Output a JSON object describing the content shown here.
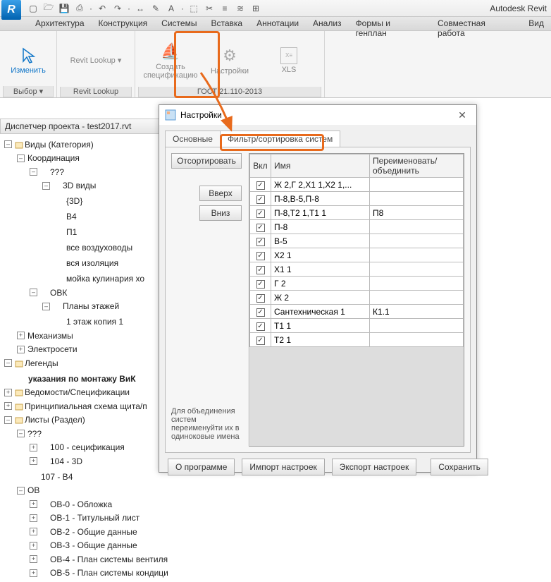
{
  "app_title": "Autodesk Revit",
  "logo_letter": "R",
  "qat_icons": [
    "new-icon",
    "open-icon",
    "save-icon",
    "paste-icon",
    "undo-icon",
    "redo-icon",
    "dimension-icon",
    "measure-icon",
    "text-icon",
    "3d-icon",
    "section-icon",
    "tag-icon",
    "thin-icon",
    "close-icon"
  ],
  "menus": [
    "Архитектура",
    "Конструкция",
    "Системы",
    "Вставка",
    "Аннотации",
    "Анализ",
    "Формы и генплан",
    "Совместная работа",
    "Вид"
  ],
  "ribbon": {
    "groups": [
      {
        "label": "Выбор ▾",
        "buttons": [
          {
            "label": "Изменить",
            "icon": "cursor"
          }
        ]
      },
      {
        "label": "Revit Lookup",
        "buttons": [
          {
            "label": "Revit Lookup ▾",
            "icon": ""
          }
        ]
      },
      {
        "label": "ГОСТ 21.110-2013",
        "buttons": [
          {
            "label": "Создать спецификацию",
            "icon": "boat"
          },
          {
            "label": "Настройки",
            "icon": "gear"
          },
          {
            "label": "XLS",
            "icon": "xls"
          }
        ]
      }
    ]
  },
  "project_browser": {
    "title": "Диспетчер проекта - test2017.rvt",
    "tree": [
      {
        "l": 1,
        "exp": "-",
        "label": "Виды (Категория)",
        "icon": "views"
      },
      {
        "l": 2,
        "exp": "-",
        "label": "Координация"
      },
      {
        "l": 3,
        "exp": "-",
        "label": "???"
      },
      {
        "l": 4,
        "exp": "-",
        "label": "3D виды"
      },
      {
        "l": 5,
        "label": "{3D}"
      },
      {
        "l": 5,
        "label": "B4"
      },
      {
        "l": 5,
        "label": "П1"
      },
      {
        "l": 5,
        "label": "все воздуховоды"
      },
      {
        "l": 5,
        "label": "вся изоляция"
      },
      {
        "l": 5,
        "label": "мойка кулинария хо"
      },
      {
        "l": 3,
        "exp": "-",
        "label": "ОВК"
      },
      {
        "l": 4,
        "exp": "-",
        "label": "Планы этажей"
      },
      {
        "l": 5,
        "label": "1 этаж копия 1"
      },
      {
        "l": 2,
        "exp": "+",
        "label": "Механизмы"
      },
      {
        "l": 2,
        "exp": "+",
        "label": "Электросети"
      },
      {
        "l": 1,
        "exp": "-",
        "label": "Легенды",
        "icon": "legend"
      },
      {
        "l": 2,
        "label": "указания по монтажу ВиК",
        "bold": true
      },
      {
        "l": 1,
        "exp": "+",
        "label": "Ведомости/Спецификации",
        "icon": "sched"
      },
      {
        "l": 1,
        "exp": "+",
        "label": "Принципиальная схема щита/п",
        "icon": "panel"
      },
      {
        "l": 1,
        "exp": "-",
        "label": "Листы (Раздел)",
        "icon": "sheets"
      },
      {
        "l": 2,
        "exp": "-",
        "label": "???"
      },
      {
        "l": 3,
        "exp": "+",
        "label": "100 - сецификация"
      },
      {
        "l": 3,
        "exp": "+",
        "label": "104 - 3D"
      },
      {
        "l": 3,
        "label": "107 - B4"
      },
      {
        "l": 2,
        "exp": "-",
        "label": "ОВ"
      },
      {
        "l": 3,
        "exp": "+",
        "label": "ОВ-0 - Обложка"
      },
      {
        "l": 3,
        "exp": "+",
        "label": "ОВ-1 - Титульный лист"
      },
      {
        "l": 3,
        "exp": "+",
        "label": "ОВ-2 - Общие данные"
      },
      {
        "l": 3,
        "exp": "+",
        "label": "ОВ-3 - Общие данные"
      },
      {
        "l": 3,
        "exp": "+",
        "label": "ОВ-4 - План системы вентиля"
      },
      {
        "l": 3,
        "exp": "+",
        "label": "ОВ-5 - План системы кондици"
      }
    ]
  },
  "dialog": {
    "title": "Настройки",
    "close": "✕",
    "tabs": [
      "Основные",
      "Фильтр/сортировка систем"
    ],
    "buttons": {
      "sort": "Отсортировать",
      "up": "Вверх",
      "down": "Вниз"
    },
    "hint": "Для объединения систем переименуйти их в одиноковые имена",
    "grid": {
      "headers": [
        "Вкл",
        "Имя",
        "Переименовать/объединить"
      ],
      "rows": [
        {
          "on": true,
          "name": "Ж 2,Г 2,X1 1,X2 1,...",
          "rename": ""
        },
        {
          "on": true,
          "name": "П-8,B-5,П-8",
          "rename": ""
        },
        {
          "on": true,
          "name": "П-8,Т2 1,Т1 1",
          "rename": "П8"
        },
        {
          "on": true,
          "name": "П-8",
          "rename": ""
        },
        {
          "on": true,
          "name": "B-5",
          "rename": ""
        },
        {
          "on": true,
          "name": "X2 1",
          "rename": ""
        },
        {
          "on": true,
          "name": "X1 1",
          "rename": ""
        },
        {
          "on": true,
          "name": "Г 2",
          "rename": ""
        },
        {
          "on": true,
          "name": "Ж 2",
          "rename": ""
        },
        {
          "on": true,
          "name": "Сантехническая 1",
          "rename": "К1.1"
        },
        {
          "on": true,
          "name": "Т1 1",
          "rename": ""
        },
        {
          "on": true,
          "name": "Т2 1",
          "rename": ""
        }
      ]
    },
    "footer": {
      "about": "О программе",
      "import": "Импорт настроек",
      "export": "Экспорт настроек",
      "save": "Сохранить"
    }
  }
}
